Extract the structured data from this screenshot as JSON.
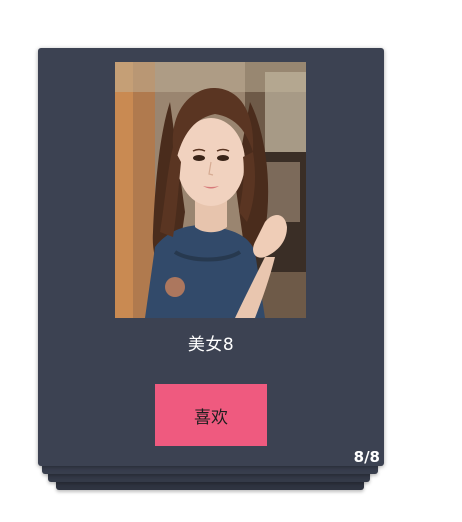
{
  "card": {
    "title": "美女8",
    "like_label": "喜欢",
    "pager": "8/8",
    "photo": "portrait-photo"
  },
  "colors": {
    "card_bg": "#3c4252",
    "like_button": "#ef5a7f",
    "page_bg": "#ffffff"
  }
}
